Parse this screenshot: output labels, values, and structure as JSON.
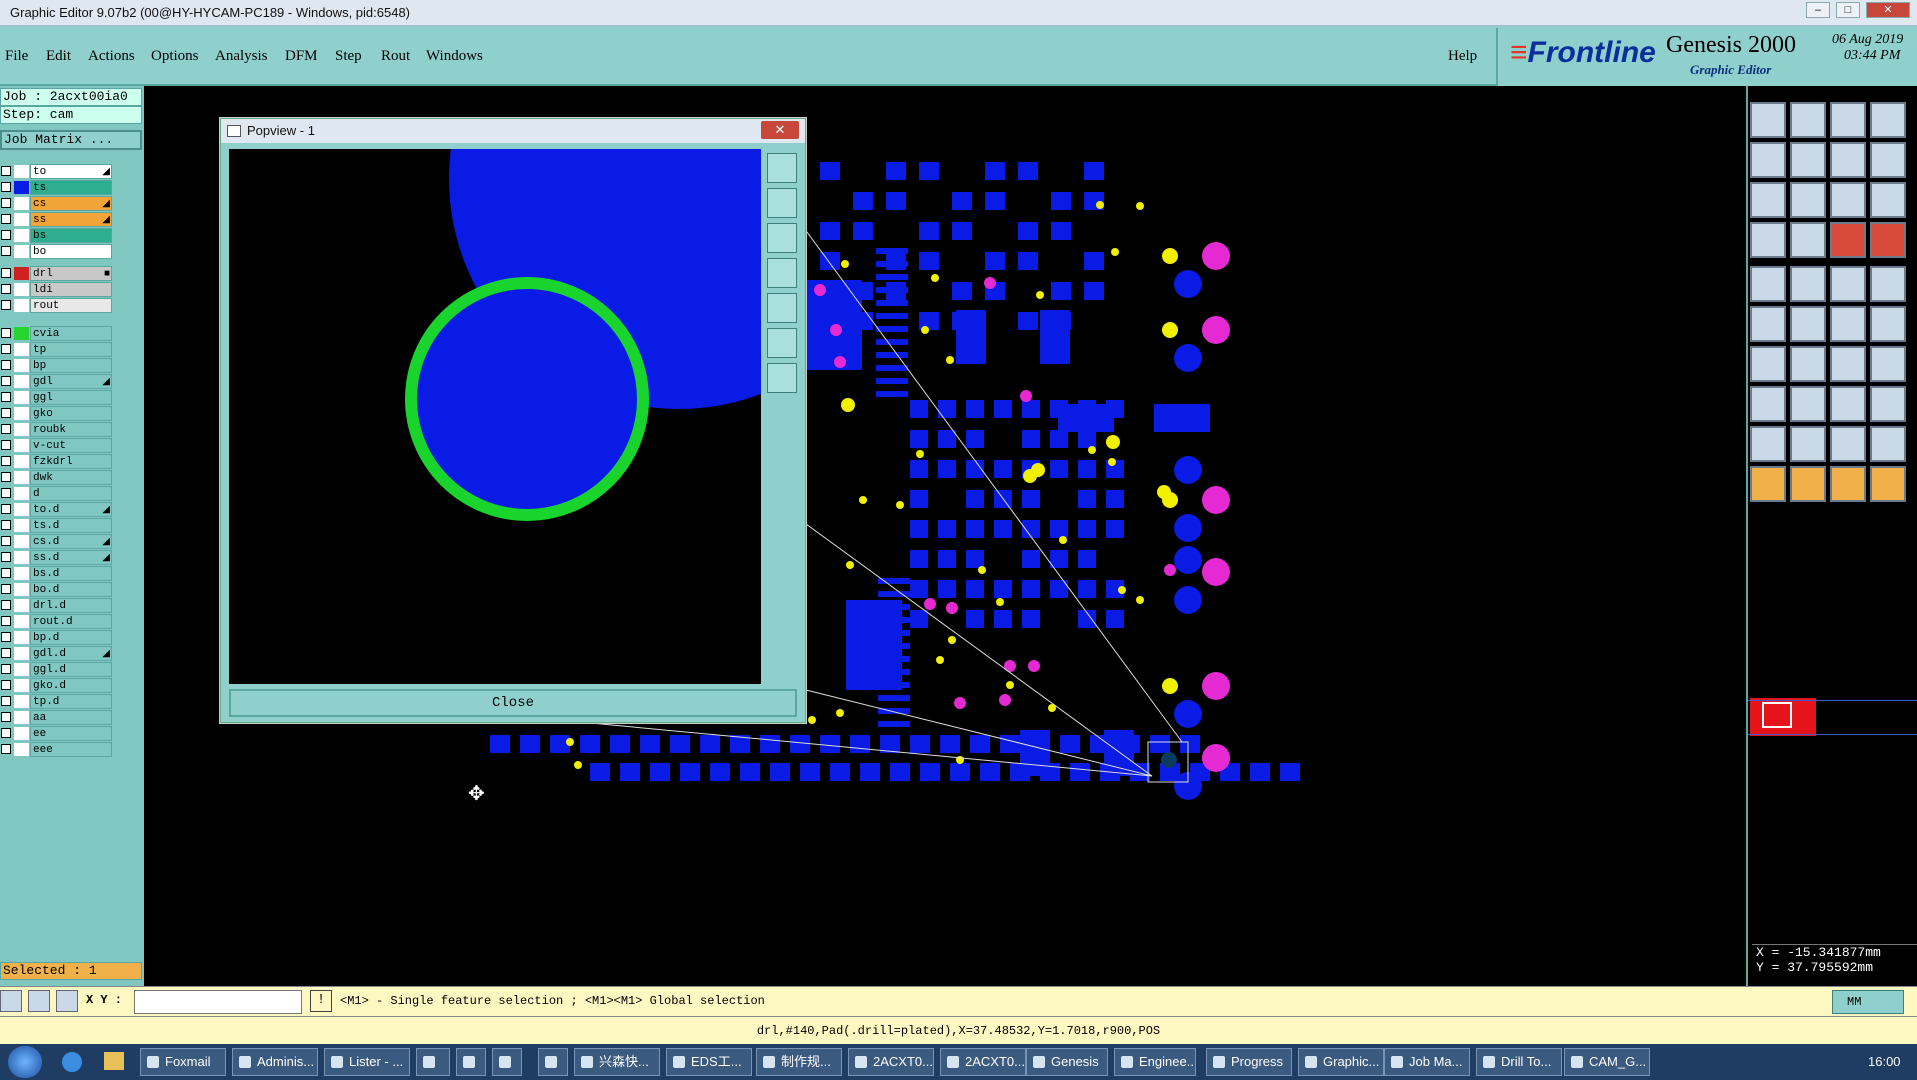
{
  "window": {
    "title": "Graphic Editor 9.07b2 (00@HY-HYCAM-PC189 - Windows, pid:6548)",
    "min_glyph": "–",
    "max_glyph": "□",
    "close_glyph": "✕"
  },
  "menu": {
    "items": [
      "File",
      "Edit",
      "Actions",
      "Options",
      "Analysis",
      "DFM",
      "Step",
      "Rout",
      "Windows"
    ],
    "help": "Help"
  },
  "brand": {
    "logo": "Frontline",
    "product": "Genesis 2000",
    "subtitle": "Graphic Editor",
    "date": "06 Aug 2019",
    "time": "03:44 PM"
  },
  "left": {
    "job": "Job : 2acxt00ia0",
    "step": "Step: cam",
    "matrix": "Job Matrix ...",
    "selected": "Selected : 1",
    "layers": [
      {
        "name": "to",
        "bg": "#ffffff",
        "sw": "#ffffff",
        "mark": "◢"
      },
      {
        "name": "ts",
        "bg": "#2fae8f",
        "sw": "#0b1be6",
        "mark": ""
      },
      {
        "name": "cs",
        "bg": "#f1a437",
        "sw": "#ffffff",
        "mark": "◢"
      },
      {
        "name": "ss",
        "bg": "#f1a437",
        "sw": "#ffffff",
        "mark": "◢"
      },
      {
        "name": "bs",
        "bg": "#2fae8f",
        "sw": "#ffffff",
        "mark": ""
      },
      {
        "name": "bo",
        "bg": "#ffffff",
        "sw": "#ffffff",
        "mark": ""
      },
      {
        "name": "drl",
        "bg": "#c8c8c8",
        "sw": "#d02020",
        "mark": "■"
      },
      {
        "name": "ldi",
        "bg": "#c8c8c8",
        "sw": "#ffffff",
        "mark": ""
      },
      {
        "name": "rout",
        "bg": "#e8e8e8",
        "sw": "#ffffff",
        "mark": ""
      },
      {
        "name": "cvia",
        "bg": "#7fc7c0",
        "sw": "#26d32f",
        "mark": ""
      },
      {
        "name": "tp",
        "bg": "#7fc7c0",
        "sw": "#ffffff",
        "mark": ""
      },
      {
        "name": "bp",
        "bg": "#7fc7c0",
        "sw": "#ffffff",
        "mark": ""
      },
      {
        "name": "gdl",
        "bg": "#7fc7c0",
        "sw": "#ffffff",
        "mark": "◢"
      },
      {
        "name": "ggl",
        "bg": "#7fc7c0",
        "sw": "#ffffff",
        "mark": ""
      },
      {
        "name": "gko",
        "bg": "#7fc7c0",
        "sw": "#ffffff",
        "mark": ""
      },
      {
        "name": "roubk",
        "bg": "#7fc7c0",
        "sw": "#ffffff",
        "mark": ""
      },
      {
        "name": "v-cut",
        "bg": "#7fc7c0",
        "sw": "#ffffff",
        "mark": ""
      },
      {
        "name": "fzkdrl",
        "bg": "#7fc7c0",
        "sw": "#ffffff",
        "mark": ""
      },
      {
        "name": "dwk",
        "bg": "#7fc7c0",
        "sw": "#ffffff",
        "mark": ""
      },
      {
        "name": "d",
        "bg": "#7fc7c0",
        "sw": "#ffffff",
        "mark": ""
      },
      {
        "name": "to.d",
        "bg": "#7fc7c0",
        "sw": "#ffffff",
        "mark": "◢"
      },
      {
        "name": "ts.d",
        "bg": "#7fc7c0",
        "sw": "#ffffff",
        "mark": ""
      },
      {
        "name": "cs.d",
        "bg": "#7fc7c0",
        "sw": "#ffffff",
        "mark": "◢"
      },
      {
        "name": "ss.d",
        "bg": "#7fc7c0",
        "sw": "#ffffff",
        "mark": "◢"
      },
      {
        "name": "bs.d",
        "bg": "#7fc7c0",
        "sw": "#ffffff",
        "mark": ""
      },
      {
        "name": "bo.d",
        "bg": "#7fc7c0",
        "sw": "#ffffff",
        "mark": ""
      },
      {
        "name": "drl.d",
        "bg": "#7fc7c0",
        "sw": "#ffffff",
        "mark": ""
      },
      {
        "name": "rout.d",
        "bg": "#7fc7c0",
        "sw": "#ffffff",
        "mark": ""
      },
      {
        "name": "bp.d",
        "bg": "#7fc7c0",
        "sw": "#ffffff",
        "mark": ""
      },
      {
        "name": "gdl.d",
        "bg": "#7fc7c0",
        "sw": "#ffffff",
        "mark": "◢"
      },
      {
        "name": "ggl.d",
        "bg": "#7fc7c0",
        "sw": "#ffffff",
        "mark": ""
      },
      {
        "name": "gko.d",
        "bg": "#7fc7c0",
        "sw": "#ffffff",
        "mark": ""
      },
      {
        "name": "tp.d",
        "bg": "#7fc7c0",
        "sw": "#ffffff",
        "mark": ""
      },
      {
        "name": "aa",
        "bg": "#7fc7c0",
        "sw": "#ffffff",
        "mark": ""
      },
      {
        "name": "ee",
        "bg": "#7fc7c0",
        "sw": "#ffffff",
        "mark": ""
      },
      {
        "name": "eee",
        "bg": "#7fc7c0",
        "sw": "#ffffff",
        "mark": ""
      }
    ]
  },
  "popview": {
    "title": "Popview - 1",
    "close_label": "Close",
    "close_x": "✕"
  },
  "coords": {
    "x": "X = -15.341877mm",
    "y": "Y = 37.795592mm"
  },
  "cmd": {
    "xy_label": "X Y :",
    "xy_value": "",
    "hint": "<M1> - Single feature selection ; <M1><M1> Global selection",
    "units": "MM"
  },
  "status": {
    "text": "drl,#140,Pad(.drill=plated),X=37.48532,Y=1.7018,r900,POS"
  },
  "taskbar": {
    "items": [
      "Foxmail",
      "Adminis...",
      "Lister - ...",
      "",
      "",
      "",
      "",
      "兴森快...",
      "EDS工...",
      "制作规...",
      "2ACXT0...",
      "2ACXT0...",
      "Genesis",
      "Enginee...",
      "Progress",
      "Graphic...",
      "Job Ma...",
      "Drill To...",
      "CAM_G..."
    ],
    "clock": "16:00"
  }
}
